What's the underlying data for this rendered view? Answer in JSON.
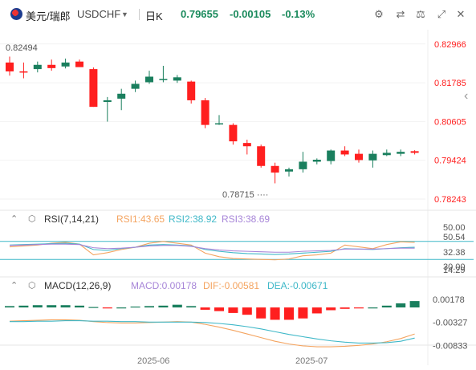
{
  "header": {
    "pair_name": "美元/瑞郎",
    "symbol": "USDCHF",
    "timeframe": "日K",
    "price": "0.79655",
    "change": "-0.00105",
    "change_pct": "-0.13%"
  },
  "toolbar": {
    "icons": [
      "settings-sliders-icon",
      "shuffle-icon",
      "scale-icon",
      "expand-icon",
      "close-icon"
    ]
  },
  "colors": {
    "up": "#1a7f5e",
    "down": "#ff1f1f",
    "rsi1": "#f4a460",
    "rsi2": "#3fb8c8",
    "rsi3": "#a785d8",
    "dif": "#f4a460",
    "dea": "#3fb8c8",
    "axis": "#ff1f1f"
  },
  "rsi": {
    "label": "RSI(7,14,21)",
    "rsi1": "RSI1:43.65",
    "rsi2": "RSI2:38.92",
    "rsi3": "RSI3:38.69"
  },
  "macd": {
    "label": "MACD(12,26,9)",
    "macd": "MACD:0.00178",
    "dif": "DIF:-0.00581",
    "dea": "DEA:-0.00671"
  },
  "chart_data": [
    {
      "type": "candlestick",
      "title": "USDCHF 日K",
      "price_ticks": [
        "0.82966",
        "0.81785",
        "0.80605",
        "0.79424",
        "0.78243"
      ],
      "ylim": [
        0.779,
        0.834
      ],
      "annotations": {
        "high": "0.82494",
        "low": "0.78715"
      },
      "x_labels": [
        "2025-06",
        "2025-07"
      ],
      "candles": [
        {
          "o": 0.824,
          "h": 0.8258,
          "l": 0.82,
          "c": 0.8213
        },
        {
          "o": 0.8213,
          "h": 0.824,
          "l": 0.8192,
          "c": 0.821
        },
        {
          "o": 0.822,
          "h": 0.8243,
          "l": 0.821,
          "c": 0.8233
        },
        {
          "o": 0.8233,
          "h": 0.8249,
          "l": 0.8215,
          "c": 0.8223
        },
        {
          "o": 0.8228,
          "h": 0.8252,
          "l": 0.8222,
          "c": 0.824
        },
        {
          "o": 0.8243,
          "h": 0.8249,
          "l": 0.8228,
          "c": 0.8226
        },
        {
          "o": 0.822,
          "h": 0.8225,
          "l": 0.8105,
          "c": 0.8105
        },
        {
          "o": 0.812,
          "h": 0.8135,
          "l": 0.806,
          "c": 0.8125
        },
        {
          "o": 0.813,
          "h": 0.816,
          "l": 0.8095,
          "c": 0.8145
        },
        {
          "o": 0.816,
          "h": 0.8185,
          "l": 0.815,
          "c": 0.8175
        },
        {
          "o": 0.818,
          "h": 0.8215,
          "l": 0.8175,
          "c": 0.8197
        },
        {
          "o": 0.8188,
          "h": 0.823,
          "l": 0.818,
          "c": 0.819
        },
        {
          "o": 0.8185,
          "h": 0.8202,
          "l": 0.8178,
          "c": 0.8195
        },
        {
          "o": 0.8182,
          "h": 0.8185,
          "l": 0.8115,
          "c": 0.8125
        },
        {
          "o": 0.8125,
          "h": 0.8132,
          "l": 0.804,
          "c": 0.805
        },
        {
          "o": 0.8055,
          "h": 0.808,
          "l": 0.805,
          "c": 0.8055
        },
        {
          "o": 0.805,
          "h": 0.8055,
          "l": 0.799,
          "c": 0.8
        },
        {
          "o": 0.7995,
          "h": 0.8005,
          "l": 0.796,
          "c": 0.7985
        },
        {
          "o": 0.7985,
          "h": 0.799,
          "l": 0.792,
          "c": 0.7925
        },
        {
          "o": 0.7925,
          "h": 0.7935,
          "l": 0.7872,
          "c": 0.7905
        },
        {
          "o": 0.7908,
          "h": 0.792,
          "l": 0.7893,
          "c": 0.7915
        },
        {
          "o": 0.7915,
          "h": 0.7968,
          "l": 0.7905,
          "c": 0.7938
        },
        {
          "o": 0.7938,
          "h": 0.7948,
          "l": 0.793,
          "c": 0.7944
        },
        {
          "o": 0.794,
          "h": 0.7975,
          "l": 0.793,
          "c": 0.7972
        },
        {
          "o": 0.7972,
          "h": 0.7985,
          "l": 0.7955,
          "c": 0.796
        },
        {
          "o": 0.7962,
          "h": 0.7975,
          "l": 0.7935,
          "c": 0.7943
        },
        {
          "o": 0.7942,
          "h": 0.7972,
          "l": 0.792,
          "c": 0.7962
        },
        {
          "o": 0.7958,
          "h": 0.7975,
          "l": 0.7955,
          "c": 0.7965
        },
        {
          "o": 0.7962,
          "h": 0.7975,
          "l": 0.7955,
          "c": 0.7968
        },
        {
          "o": 0.797,
          "h": 0.7973,
          "l": 0.796,
          "c": 0.7965
        }
      ]
    },
    {
      "type": "line",
      "title": "RSI(7,14,21)",
      "ticks": [
        "50.00",
        "50.54",
        "32.38",
        "30.00",
        "14.29"
      ],
      "levels": [
        70,
        30
      ],
      "series": [
        {
          "name": "RSI1",
          "values": [
            58,
            60,
            62,
            66,
            68,
            64,
            40,
            45,
            52,
            57,
            66,
            70,
            66,
            62,
            44,
            36,
            32,
            31,
            30,
            29,
            31,
            38,
            40,
            44,
            62,
            58,
            54,
            63,
            69,
            68
          ]
        },
        {
          "name": "RSI2",
          "values": [
            62,
            63,
            64,
            65,
            66,
            64,
            52,
            50,
            54,
            57,
            62,
            63,
            62,
            60,
            52,
            48,
            45,
            43,
            42,
            41,
            42,
            44,
            46,
            48,
            54,
            53,
            52,
            54,
            56,
            57
          ]
        },
        {
          "name": "RSI3",
          "values": [
            61,
            62,
            63,
            64,
            64,
            63,
            56,
            54,
            55,
            57,
            60,
            61,
            61,
            59,
            54,
            51,
            49,
            48,
            47,
            46,
            46,
            48,
            49,
            50,
            53,
            53,
            53,
            54,
            55,
            55
          ]
        }
      ]
    },
    {
      "type": "bar",
      "title": "MACD(12,26,9)",
      "ticks": [
        "0.00178",
        "-0.00327",
        "-0.00833"
      ],
      "x_labels": [
        "2025-06",
        "2025-07"
      ],
      "histogram": [
        0.0003,
        0.0004,
        0.0005,
        0.0005,
        0.0005,
        0.0004,
        0.0001,
        -0.0001,
        0.0,
        0.0002,
        0.0003,
        0.0004,
        0.0006,
        0.0003,
        -0.0005,
        -0.0008,
        -0.0012,
        -0.0016,
        -0.0024,
        -0.0027,
        -0.0027,
        -0.0024,
        -0.0013,
        -0.0006,
        -0.0003,
        -0.0001,
        0.0,
        0.0004,
        0.0009,
        0.0014
      ],
      "series": [
        {
          "name": "DIF",
          "values": [
            -0.003,
            -0.0029,
            -0.0028,
            -0.0027,
            -0.0027,
            -0.0028,
            -0.0031,
            -0.0033,
            -0.0034,
            -0.0034,
            -0.0033,
            -0.0032,
            -0.0031,
            -0.0032,
            -0.0037,
            -0.0043,
            -0.005,
            -0.0058,
            -0.0066,
            -0.0074,
            -0.008,
            -0.0084,
            -0.0086,
            -0.0086,
            -0.0085,
            -0.0083,
            -0.008,
            -0.0075,
            -0.0068,
            -0.0058
          ]
        },
        {
          "name": "DEA",
          "values": [
            -0.0031,
            -0.0031,
            -0.003,
            -0.003,
            -0.0029,
            -0.0029,
            -0.003,
            -0.003,
            -0.0031,
            -0.0031,
            -0.0032,
            -0.0032,
            -0.0032,
            -0.0032,
            -0.0033,
            -0.0035,
            -0.0038,
            -0.0042,
            -0.0047,
            -0.0053,
            -0.0059,
            -0.0064,
            -0.0069,
            -0.0073,
            -0.0076,
            -0.0078,
            -0.0078,
            -0.0077,
            -0.0074,
            -0.0067
          ]
        }
      ]
    }
  ]
}
